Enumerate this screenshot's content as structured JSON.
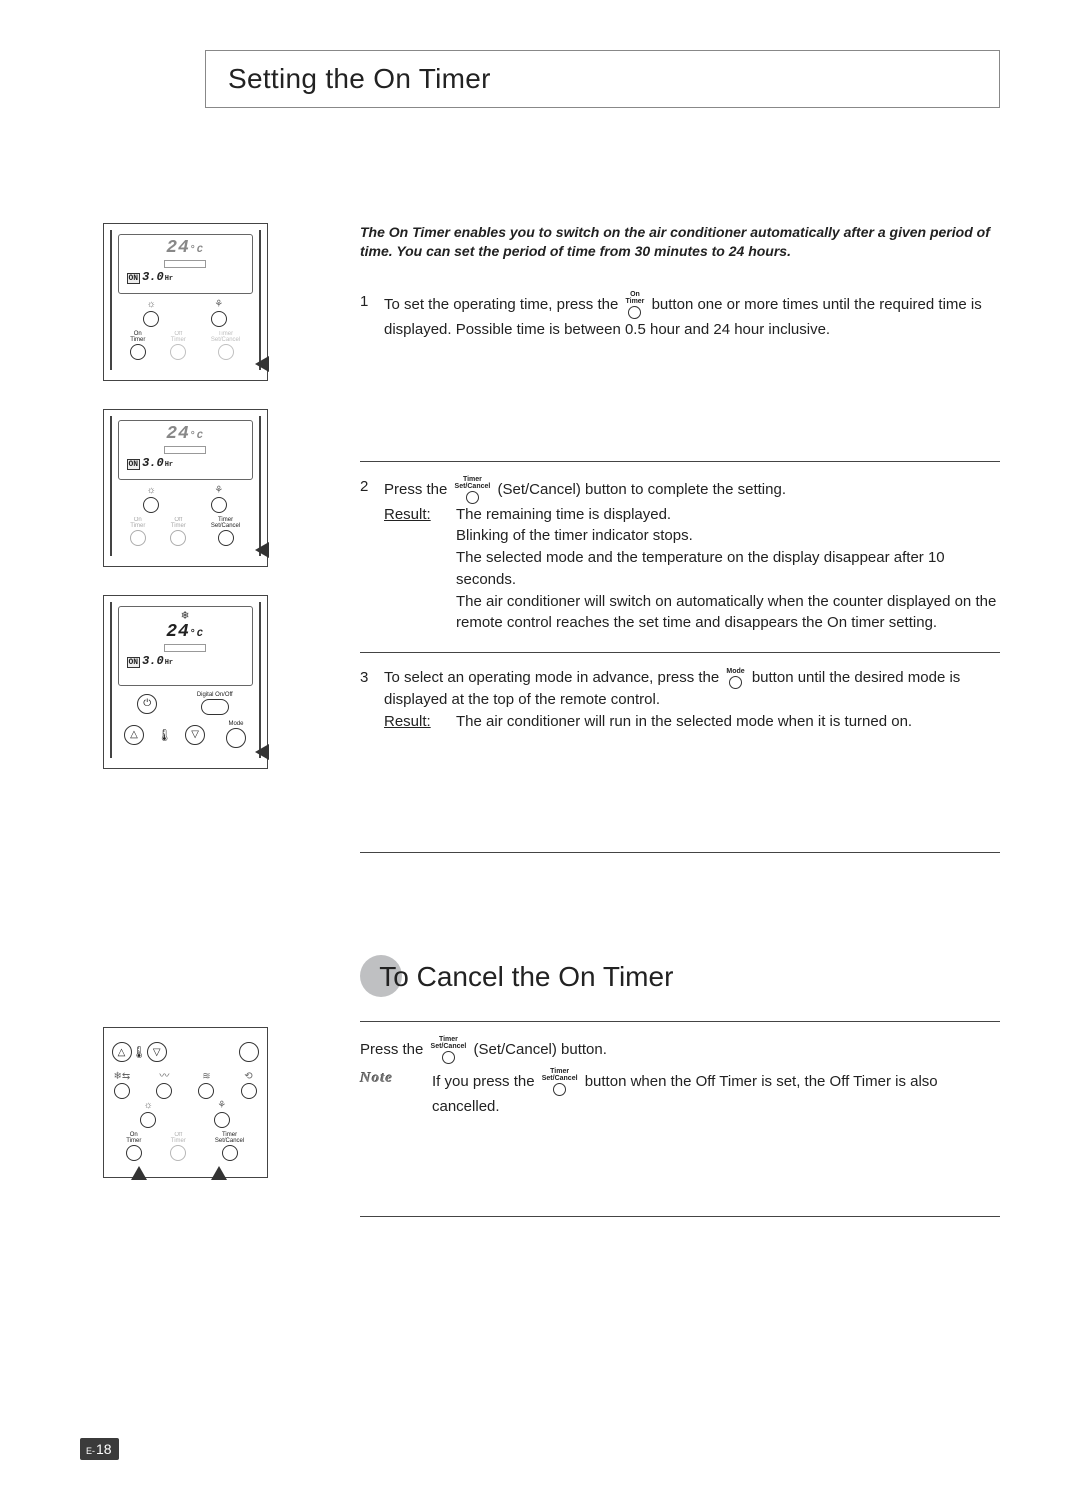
{
  "page_title": "Setting the On Timer",
  "intro": "The On Timer enables you to switch on the air conditioner automatically after a given period of time. You can set the period of time from 30 minutes to 24 hours.",
  "inline_buttons": {
    "on_timer": {
      "l1": "On",
      "l2": "Timer"
    },
    "set_cancel": {
      "l1": "Timer",
      "l2": "Set/Cancel"
    },
    "mode": {
      "l1": "Mode",
      "l2": ""
    }
  },
  "steps": [
    {
      "num": "1",
      "pre": "To set the operating time, press the ",
      "btn": "on_timer",
      "post": " button one or more times until the required time is displayed. Possible time is between 0.5 hour and 24 hour inclusive."
    },
    {
      "num": "2",
      "pre": "Press the ",
      "btn": "set_cancel",
      "post": " (Set/Cancel) button to complete the setting.",
      "result_label": "Result:",
      "result_lines": [
        "The remaining time is displayed.",
        "Blinking of the timer indicator stops.",
        "The selected mode and the temperature on the display disappear after 10 seconds.",
        "The air conditioner will switch on automatically when the counter displayed on the remote control reaches the set time and disappears the On timer setting."
      ]
    },
    {
      "num": "3",
      "pre": "To select an operating mode in advance, press the ",
      "btn": "mode",
      "post": " button until the desired mode is displayed at the top of the remote control.",
      "result_label": "Result:",
      "result_lines": [
        "The air conditioner will run in the selected mode when it is turned on."
      ]
    }
  ],
  "section2_title": "To Cancel the On Timer",
  "cancel": {
    "pre": "Press the ",
    "btn": "set_cancel",
    "post": " (Set/Cancel) button.",
    "note_label": "Note",
    "note_pre": "If you press the ",
    "note_btn": "set_cancel",
    "note_post": " button when the Off Timer is set, the Off Timer is also cancelled."
  },
  "remotes": {
    "temp": "24",
    "temp_unit": "°C",
    "hr_value": "3.0",
    "hr_unit": "Hr",
    "on_badge": "ON",
    "labels": {
      "on_timer": "On\nTimer",
      "off_timer": "Off\nTimer",
      "timer_set": "Timer\nSet/Cancel",
      "digital": "Digital   On/Off",
      "mode": "Mode"
    }
  },
  "page_number": {
    "prefix": "E-",
    "num": "18"
  }
}
